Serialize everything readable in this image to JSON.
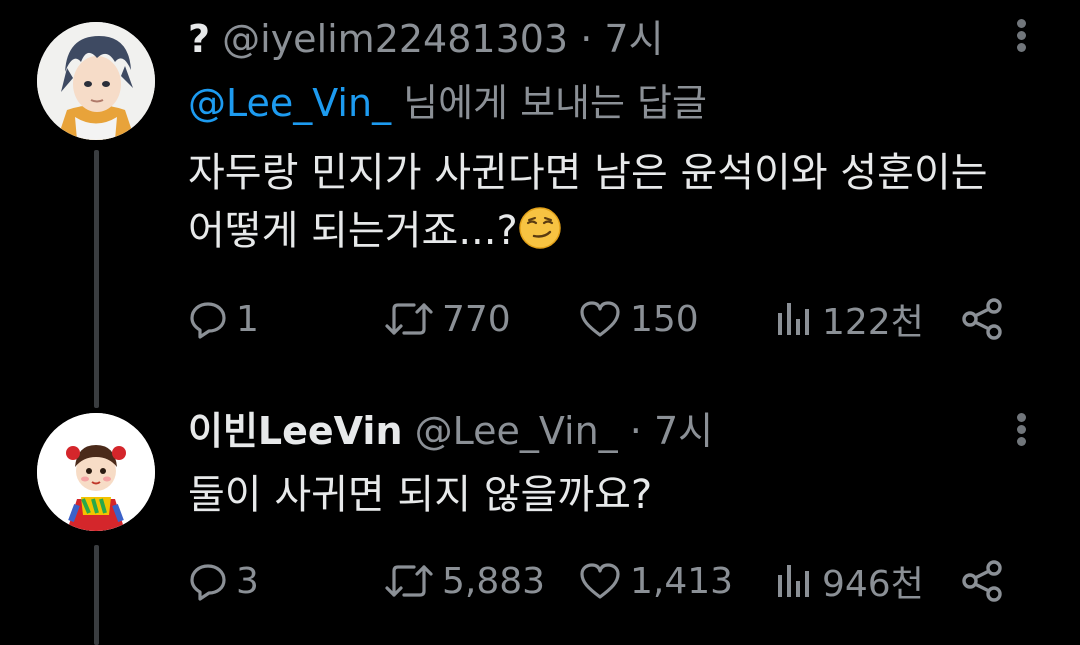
{
  "tweets": [
    {
      "display_name": "?",
      "handle": "@iyelim22481303",
      "separator": "·",
      "time": "7시",
      "replying_to_mention": "@Lee_Vin_",
      "replying_to_suffix": " 님에게 보내는 답글",
      "text_line1": "자두랑 민지가 사귄다면 남은 윤석이와 성훈이는",
      "text_line2": "어떻게 되는거죠...?",
      "emoji": "smirking-face",
      "actions": {
        "replies": "1",
        "retweets": "770",
        "likes": "150",
        "views": "122천"
      }
    },
    {
      "display_name": "이빈LeeVin",
      "handle": "@Lee_Vin_",
      "separator": "·",
      "time": "7시",
      "text_line1": "둘이 사귀면 되지 않을까요?",
      "actions": {
        "replies": "3",
        "retweets": "5,883",
        "likes": "1,413",
        "views": "946천"
      }
    }
  ],
  "colors": {
    "background": "#000000",
    "text": "#e7e9ea",
    "muted": "#8b9096",
    "mention": "#1d9bf0",
    "thread_line": "#3a3d40"
  }
}
